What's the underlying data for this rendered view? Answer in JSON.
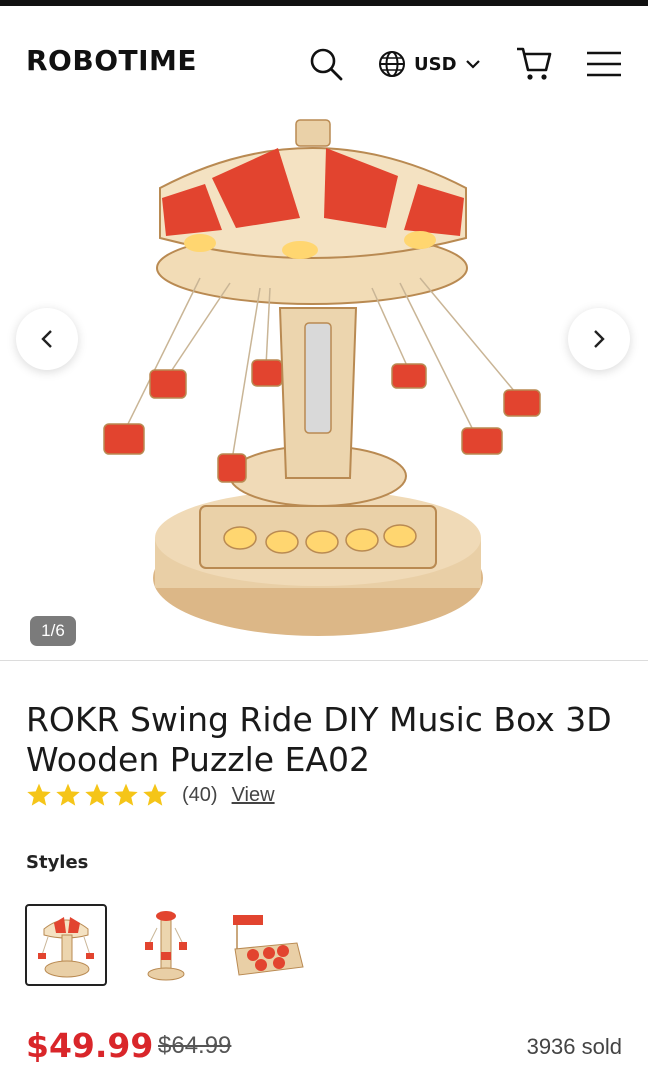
{
  "header": {
    "logo": "ROBOTIME",
    "currency": "USD",
    "icons": [
      "search-icon",
      "globe-icon",
      "chevron-down-icon",
      "cart-icon",
      "menu-icon"
    ]
  },
  "gallery": {
    "counter": "1/6",
    "image": "swing-ride-music-box-image",
    "prev_icon": "chevron-left-icon",
    "next_icon": "chevron-right-icon"
  },
  "product": {
    "title": "ROKR Swing Ride DIY Music Box 3D Wooden Puzzle EA02",
    "rating_stars": 5,
    "rating_count": "(40)",
    "view_label": "View",
    "styles_label": "Styles",
    "styles": [
      "swing-ride-thumb",
      "tower-ride-thumb",
      "boat-ride-thumb"
    ],
    "selected_style": 0,
    "price": "$49.99",
    "compare_price": "$64.99",
    "sold": "3936 sold"
  },
  "colors": {
    "accent_red": "#d9262a",
    "star_yellow": "#f5c518",
    "wood": "#e9cfa6",
    "canopy_red": "#e2442f"
  }
}
